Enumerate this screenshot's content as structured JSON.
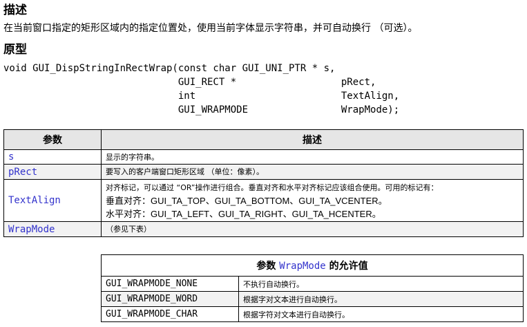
{
  "sections": {
    "description_heading": "描述",
    "description_text": "在当前窗口指定的矩形区域内的指定位置处，使用当前字体显示字符串，并可自动换行 （可选）。",
    "prototype_heading": "原型"
  },
  "prototype": {
    "lines": [
      "void GUI_DispStringInRectWrap(const char GUI_UNI_PTR * s,",
      "                              GUI_RECT *                  pRect,",
      "                              int                         TextAlign,",
      "                              GUI_WRAPMODE                WrapMode);"
    ]
  },
  "param_table": {
    "headers": [
      "参数",
      "描述"
    ],
    "rows": [
      {
        "name": "s",
        "desc_lines": [
          "显示的字符串。"
        ]
      },
      {
        "name": "pRect",
        "desc_lines": [
          "要写入的客户端窗口矩形区域 （单位：像素）。"
        ]
      },
      {
        "name": "TextAlign",
        "desc_lines": [
          "对齐标记，可以通过 “OR”操作进行组合。垂直对齐和水平对齐标记应该组合使用。可用的标记有：",
          "垂直对齐：GUI_TA_TOP、GUI_TA_BOTTOM、GUI_TA_VCENTER。",
          "水平对齐：GUI_TA_LEFT、GUI_TA_RIGHT、GUI_TA_HCENTER。"
        ]
      },
      {
        "name": "WrapMode",
        "desc_lines": [
          "（参见下表）"
        ]
      }
    ]
  },
  "wrap_table": {
    "header_prefix": "参数 ",
    "header_code": "WrapMode",
    "header_suffix": " 的允许值",
    "rows": [
      {
        "name": "GUI_WRAPMODE_NONE",
        "desc": "不执行自动换行。"
      },
      {
        "name": "GUI_WRAPMODE_WORD",
        "desc": "根据字对文本进行自动换行。"
      },
      {
        "name": "GUI_WRAPMODE_CHAR",
        "desc": "根据字符对文本进行自动换行。"
      }
    ]
  },
  "colors": {
    "param_name": "#3333cc",
    "header_bg": "#e6e6e6",
    "row_bg": "#f2f2f2"
  }
}
